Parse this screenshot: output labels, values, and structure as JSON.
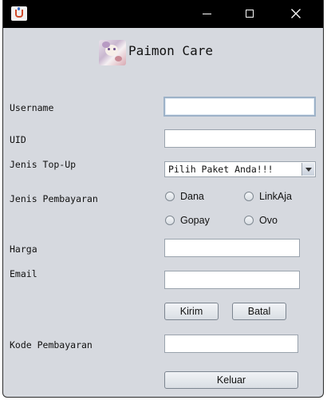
{
  "header": {
    "title": "Paimon Care"
  },
  "window_controls": {
    "minimize_icon": "minimize-icon",
    "maximize_icon": "maximize-icon",
    "close_icon": "close-icon"
  },
  "form": {
    "username_label": "Username",
    "uid_label": "UID",
    "topup_label": "Jenis Top-Up",
    "topup_selected": "Pilih Paket Anda!!!",
    "payment_label": "Jenis Pembayaran",
    "payment_options": [
      "Dana",
      "LinkAja",
      "Gopay",
      "Ovo"
    ],
    "price_label": "Harga",
    "email_label": "Email",
    "submit_label": "Kirim",
    "cancel_label": "Batal",
    "payment_code_label": "Kode Pembayaran",
    "exit_label": "Keluar",
    "username_value": "",
    "uid_value": "",
    "price_value": "",
    "email_value": "",
    "payment_code_value": ""
  }
}
